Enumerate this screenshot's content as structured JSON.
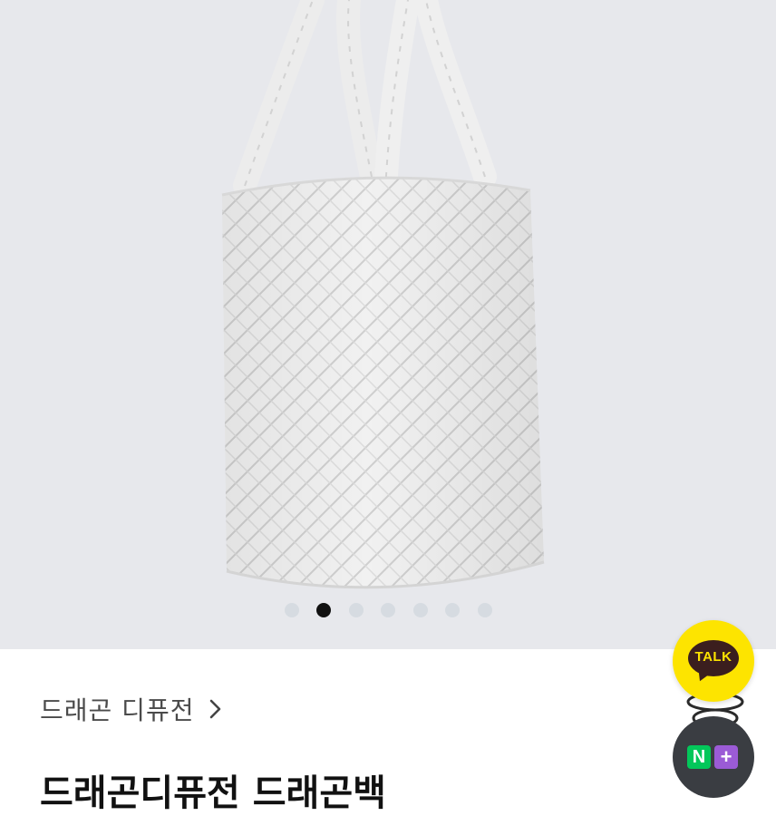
{
  "product": {
    "image_alt": "white woven leather bucket bag",
    "gallery": {
      "total": 7,
      "active_index": 1
    }
  },
  "brand": {
    "name": "드래곤 디퓨전"
  },
  "title": {
    "text": "드래곤디퓨전 드래곤백"
  },
  "floating": {
    "talk_label": "TALK",
    "naver_n": "N",
    "naver_plus": "+"
  },
  "colors": {
    "background": "#e7e8ec",
    "talk_yellow": "#fde400",
    "naver_green": "#03c75a",
    "naver_purple": "#9b5bd6"
  },
  "icons": [
    "chevron-right-icon",
    "kakao-talk-icon",
    "naver-plus-icon"
  ]
}
